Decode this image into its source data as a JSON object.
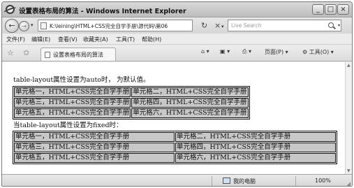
{
  "window": {
    "title": "设置表格布局的算法 - Windows Internet Explorer",
    "min_glyph": "_",
    "max_glyph": "□",
    "close_glyph": "×"
  },
  "address_bar": {
    "back_glyph": "←",
    "forward_glyph": "→",
    "url": "K:\\leining\\HTML+CSS完全自学手册\\源代码\\第06",
    "refresh_glyph": "↻",
    "stop_glyph": "×",
    "search_placeholder": "Live Search"
  },
  "menu": [
    "文件(F)",
    "编辑(E)",
    "查看(V)",
    "收藏夹(A)",
    "工具(T)",
    "帮助(H)"
  ],
  "tabbar": {
    "tab_title": "设置表格布局的算法",
    "commands": {
      "home": "⌂ ▾",
      "feeds": "▣ ▾",
      "print": "⎙ ▾",
      "page": "页面(P) ▾",
      "tools": "⚙ 工具(O) ▾"
    }
  },
  "content": {
    "paragraph_auto": "table-layout属性设置为auto时， 为默认值。",
    "table_auto": [
      [
        "单元格一，HTML+CSS完全自学手册",
        "单元格二，HTML+CSS完全自学手册"
      ],
      [
        "单元格三，HTML+CSS完全自学手册",
        "单元格四，HTML+CSS完全自学手册"
      ],
      [
        "单元格五，HTML+CSS完全自学手册",
        "单元格六，HTML+CSS完全自学手册"
      ]
    ],
    "paragraph_fixed": "当table-layout属性设置为fixed时：",
    "table_fixed": [
      [
        "单元格一，HTML+CSS完全自学手册",
        "单元格二，HTML+CSS完全自学手册"
      ],
      [
        "单元格三，HTML+CSS完全自学手册",
        "单元格四，HTML+CSS完全自学手册"
      ],
      [
        "单元格五，HTML+CSS完全自学手册",
        "单元格六，HTML+CSS完全自学手册"
      ]
    ]
  },
  "statusbar": {
    "zone": "我的电脑",
    "zoom": "100%"
  }
}
